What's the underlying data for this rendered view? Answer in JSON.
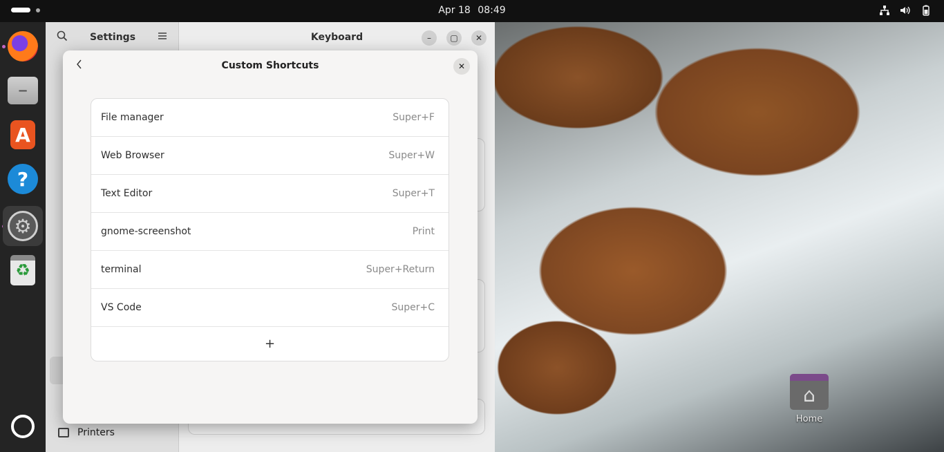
{
  "topbar": {
    "date": "Apr 18",
    "time": "08:49"
  },
  "settings": {
    "sidebar_title": "Settings",
    "page_title": "Keyboard",
    "printers_label": "Printers"
  },
  "dialog": {
    "title": "Custom Shortcuts",
    "shortcuts": [
      {
        "name": "File manager",
        "accel": "Super+F"
      },
      {
        "name": "Web Browser",
        "accel": "Super+W"
      },
      {
        "name": "Text Editor",
        "accel": "Super+T"
      },
      {
        "name": "gnome-screenshot",
        "accel": "Print"
      },
      {
        "name": "terminal",
        "accel": "Super+Return"
      },
      {
        "name": "VS Code",
        "accel": "Super+C"
      }
    ],
    "add_label": "+"
  },
  "desktop": {
    "home_label": "Home"
  },
  "dock": {
    "apps": [
      "firefox-icon",
      "files-icon",
      "app-center-icon",
      "help-icon",
      "settings-icon",
      "trash-icon",
      "ubuntu-apps-icon"
    ]
  }
}
